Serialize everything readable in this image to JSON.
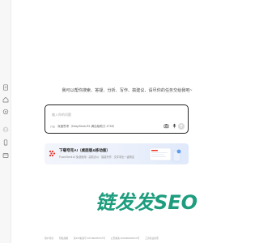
{
  "prompt": "我可以帮你搜索、答疑、分析、写作、搞建议、请尽你的任务交给我吧~",
  "chat": {
    "placeholder": "输入你的问题",
    "mode_label": "深度思考（DeepSeek-R1 满血版助力 471B）"
  },
  "banner": {
    "title": "下载夸克AI（桌面版&移动版）",
    "subtitle": "PowerSeek AI 免费使用 · 高效办公 · 智能写作 · 文件导出一键搞定"
  },
  "footer": {
    "items": [
      "用户协议",
      "隐私政策",
      "琼ICP备案号 ICP180235XXX号",
      "公安备案 46010602000XX号",
      "工商营业执照"
    ]
  },
  "colors": {
    "accent": "#1e9d7e",
    "watermark": "#1e9d7e",
    "brand_red": "#e8332a"
  },
  "icons": {
    "sidebar": [
      "document-icon",
      "home-icon",
      "star-icon",
      "avatar-icon",
      "phone-icon",
      "window-icon"
    ],
    "chat_tools": [
      "camera-icon",
      "microphone-icon",
      "send-icon"
    ]
  }
}
